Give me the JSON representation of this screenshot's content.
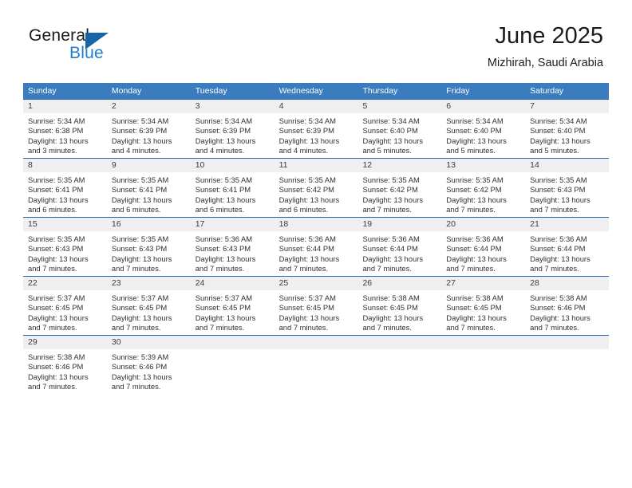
{
  "brand": {
    "name_part1": "General",
    "name_part2": "Blue"
  },
  "header": {
    "month_title": "June 2025",
    "location": "Mizhirah, Saudi Arabia"
  },
  "colors": {
    "header_blue": "#3a7cbe",
    "rule_blue": "#1f65a8",
    "day_band_gray": "#efefef",
    "brand_blue": "#1c7fd4"
  },
  "weekdays": [
    "Sunday",
    "Monday",
    "Tuesday",
    "Wednesday",
    "Thursday",
    "Friday",
    "Saturday"
  ],
  "weeks": [
    [
      {
        "day": "1",
        "sunrise": "Sunrise: 5:34 AM",
        "sunset": "Sunset: 6:38 PM",
        "daylight1": "Daylight: 13 hours",
        "daylight2": "and 3 minutes."
      },
      {
        "day": "2",
        "sunrise": "Sunrise: 5:34 AM",
        "sunset": "Sunset: 6:39 PM",
        "daylight1": "Daylight: 13 hours",
        "daylight2": "and 4 minutes."
      },
      {
        "day": "3",
        "sunrise": "Sunrise: 5:34 AM",
        "sunset": "Sunset: 6:39 PM",
        "daylight1": "Daylight: 13 hours",
        "daylight2": "and 4 minutes."
      },
      {
        "day": "4",
        "sunrise": "Sunrise: 5:34 AM",
        "sunset": "Sunset: 6:39 PM",
        "daylight1": "Daylight: 13 hours",
        "daylight2": "and 4 minutes."
      },
      {
        "day": "5",
        "sunrise": "Sunrise: 5:34 AM",
        "sunset": "Sunset: 6:40 PM",
        "daylight1": "Daylight: 13 hours",
        "daylight2": "and 5 minutes."
      },
      {
        "day": "6",
        "sunrise": "Sunrise: 5:34 AM",
        "sunset": "Sunset: 6:40 PM",
        "daylight1": "Daylight: 13 hours",
        "daylight2": "and 5 minutes."
      },
      {
        "day": "7",
        "sunrise": "Sunrise: 5:34 AM",
        "sunset": "Sunset: 6:40 PM",
        "daylight1": "Daylight: 13 hours",
        "daylight2": "and 5 minutes."
      }
    ],
    [
      {
        "day": "8",
        "sunrise": "Sunrise: 5:35 AM",
        "sunset": "Sunset: 6:41 PM",
        "daylight1": "Daylight: 13 hours",
        "daylight2": "and 6 minutes."
      },
      {
        "day": "9",
        "sunrise": "Sunrise: 5:35 AM",
        "sunset": "Sunset: 6:41 PM",
        "daylight1": "Daylight: 13 hours",
        "daylight2": "and 6 minutes."
      },
      {
        "day": "10",
        "sunrise": "Sunrise: 5:35 AM",
        "sunset": "Sunset: 6:41 PM",
        "daylight1": "Daylight: 13 hours",
        "daylight2": "and 6 minutes."
      },
      {
        "day": "11",
        "sunrise": "Sunrise: 5:35 AM",
        "sunset": "Sunset: 6:42 PM",
        "daylight1": "Daylight: 13 hours",
        "daylight2": "and 6 minutes."
      },
      {
        "day": "12",
        "sunrise": "Sunrise: 5:35 AM",
        "sunset": "Sunset: 6:42 PM",
        "daylight1": "Daylight: 13 hours",
        "daylight2": "and 7 minutes."
      },
      {
        "day": "13",
        "sunrise": "Sunrise: 5:35 AM",
        "sunset": "Sunset: 6:42 PM",
        "daylight1": "Daylight: 13 hours",
        "daylight2": "and 7 minutes."
      },
      {
        "day": "14",
        "sunrise": "Sunrise: 5:35 AM",
        "sunset": "Sunset: 6:43 PM",
        "daylight1": "Daylight: 13 hours",
        "daylight2": "and 7 minutes."
      }
    ],
    [
      {
        "day": "15",
        "sunrise": "Sunrise: 5:35 AM",
        "sunset": "Sunset: 6:43 PM",
        "daylight1": "Daylight: 13 hours",
        "daylight2": "and 7 minutes."
      },
      {
        "day": "16",
        "sunrise": "Sunrise: 5:35 AM",
        "sunset": "Sunset: 6:43 PM",
        "daylight1": "Daylight: 13 hours",
        "daylight2": "and 7 minutes."
      },
      {
        "day": "17",
        "sunrise": "Sunrise: 5:36 AM",
        "sunset": "Sunset: 6:43 PM",
        "daylight1": "Daylight: 13 hours",
        "daylight2": "and 7 minutes."
      },
      {
        "day": "18",
        "sunrise": "Sunrise: 5:36 AM",
        "sunset": "Sunset: 6:44 PM",
        "daylight1": "Daylight: 13 hours",
        "daylight2": "and 7 minutes."
      },
      {
        "day": "19",
        "sunrise": "Sunrise: 5:36 AM",
        "sunset": "Sunset: 6:44 PM",
        "daylight1": "Daylight: 13 hours",
        "daylight2": "and 7 minutes."
      },
      {
        "day": "20",
        "sunrise": "Sunrise: 5:36 AM",
        "sunset": "Sunset: 6:44 PM",
        "daylight1": "Daylight: 13 hours",
        "daylight2": "and 7 minutes."
      },
      {
        "day": "21",
        "sunrise": "Sunrise: 5:36 AM",
        "sunset": "Sunset: 6:44 PM",
        "daylight1": "Daylight: 13 hours",
        "daylight2": "and 7 minutes."
      }
    ],
    [
      {
        "day": "22",
        "sunrise": "Sunrise: 5:37 AM",
        "sunset": "Sunset: 6:45 PM",
        "daylight1": "Daylight: 13 hours",
        "daylight2": "and 7 minutes."
      },
      {
        "day": "23",
        "sunrise": "Sunrise: 5:37 AM",
        "sunset": "Sunset: 6:45 PM",
        "daylight1": "Daylight: 13 hours",
        "daylight2": "and 7 minutes."
      },
      {
        "day": "24",
        "sunrise": "Sunrise: 5:37 AM",
        "sunset": "Sunset: 6:45 PM",
        "daylight1": "Daylight: 13 hours",
        "daylight2": "and 7 minutes."
      },
      {
        "day": "25",
        "sunrise": "Sunrise: 5:37 AM",
        "sunset": "Sunset: 6:45 PM",
        "daylight1": "Daylight: 13 hours",
        "daylight2": "and 7 minutes."
      },
      {
        "day": "26",
        "sunrise": "Sunrise: 5:38 AM",
        "sunset": "Sunset: 6:45 PM",
        "daylight1": "Daylight: 13 hours",
        "daylight2": "and 7 minutes."
      },
      {
        "day": "27",
        "sunrise": "Sunrise: 5:38 AM",
        "sunset": "Sunset: 6:45 PM",
        "daylight1": "Daylight: 13 hours",
        "daylight2": "and 7 minutes."
      },
      {
        "day": "28",
        "sunrise": "Sunrise: 5:38 AM",
        "sunset": "Sunset: 6:46 PM",
        "daylight1": "Daylight: 13 hours",
        "daylight2": "and 7 minutes."
      }
    ],
    [
      {
        "day": "29",
        "sunrise": "Sunrise: 5:38 AM",
        "sunset": "Sunset: 6:46 PM",
        "daylight1": "Daylight: 13 hours",
        "daylight2": "and 7 minutes."
      },
      {
        "day": "30",
        "sunrise": "Sunrise: 5:39 AM",
        "sunset": "Sunset: 6:46 PM",
        "daylight1": "Daylight: 13 hours",
        "daylight2": "and 7 minutes."
      },
      {
        "day": "",
        "sunrise": "",
        "sunset": "",
        "daylight1": "",
        "daylight2": ""
      },
      {
        "day": "",
        "sunrise": "",
        "sunset": "",
        "daylight1": "",
        "daylight2": ""
      },
      {
        "day": "",
        "sunrise": "",
        "sunset": "",
        "daylight1": "",
        "daylight2": ""
      },
      {
        "day": "",
        "sunrise": "",
        "sunset": "",
        "daylight1": "",
        "daylight2": ""
      },
      {
        "day": "",
        "sunrise": "",
        "sunset": "",
        "daylight1": "",
        "daylight2": ""
      }
    ]
  ]
}
